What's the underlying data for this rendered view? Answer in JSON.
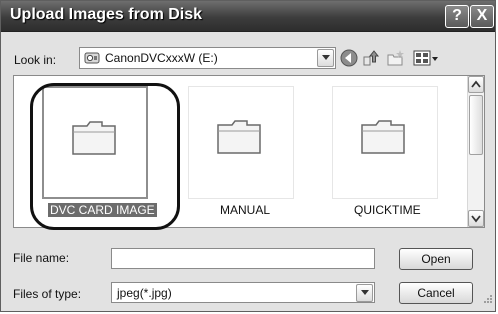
{
  "window": {
    "title": "Upload Images from Disk",
    "help_label": "?",
    "close_label": "X"
  },
  "lookin": {
    "label": "Look in:",
    "value": "CanonDVCxxxW (E:)",
    "icon": "drive-icon"
  },
  "toolbar": {
    "icons": [
      "back-icon",
      "up-folder-icon",
      "new-folder-icon",
      "view-menu-icon"
    ]
  },
  "files": [
    {
      "name": "DVC CARD IMAGE",
      "icon": "folder-icon",
      "selected": true
    },
    {
      "name": "MANUAL",
      "icon": "folder-icon",
      "selected": false
    },
    {
      "name": "QUICKTIME",
      "icon": "folder-icon",
      "selected": false
    }
  ],
  "filename": {
    "label": "File name:",
    "value": ""
  },
  "filetype": {
    "label": "Files of type:",
    "value": "jpeg(*.jpg)"
  },
  "buttons": {
    "open": "Open",
    "cancel": "Cancel"
  },
  "colors": {
    "titlebar": "#3d3d3d",
    "selection": "#6c6c6c",
    "dialog_bg": "#e2e2e2"
  }
}
